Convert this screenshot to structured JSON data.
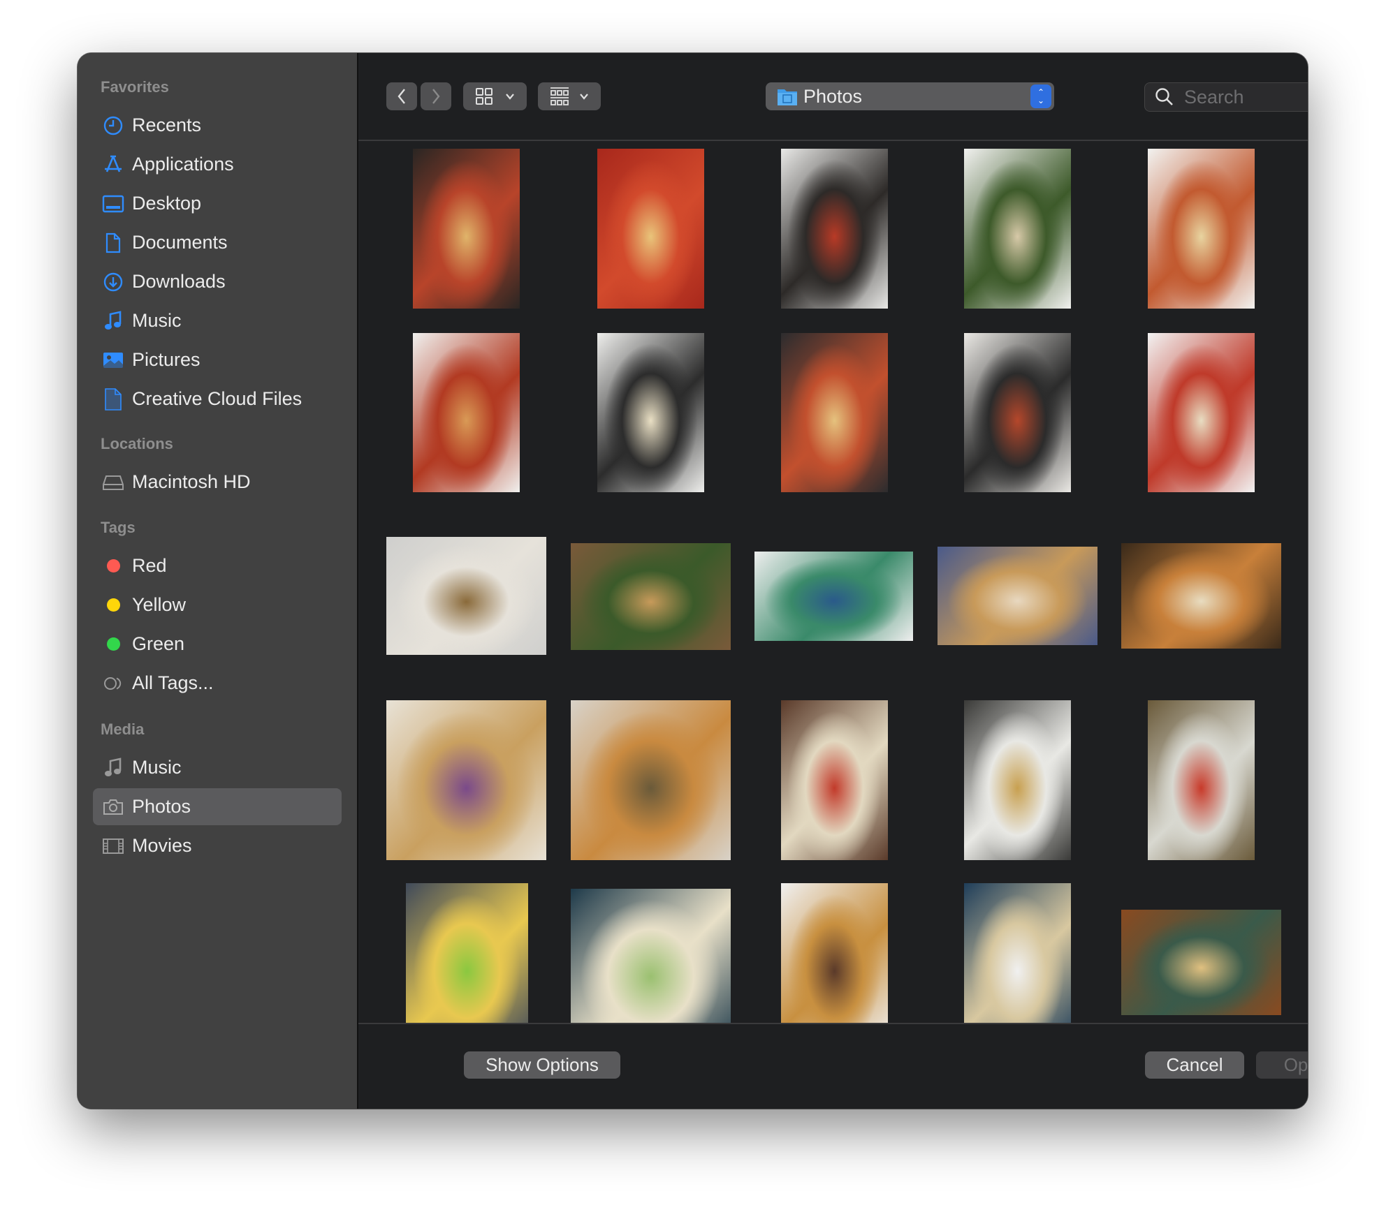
{
  "sidebar": {
    "sections": [
      {
        "title": "Favorites",
        "items": [
          {
            "label": "Recents",
            "icon": "clock-icon"
          },
          {
            "label": "Applications",
            "icon": "applications-icon"
          },
          {
            "label": "Desktop",
            "icon": "desktop-icon"
          },
          {
            "label": "Documents",
            "icon": "document-icon"
          },
          {
            "label": "Downloads",
            "icon": "download-icon"
          },
          {
            "label": "Music",
            "icon": "music-note-icon"
          },
          {
            "label": "Pictures",
            "icon": "picture-icon"
          },
          {
            "label": "Creative Cloud Files",
            "icon": "file-icon"
          }
        ]
      },
      {
        "title": "Locations",
        "items": [
          {
            "label": "Macintosh HD",
            "icon": "hard-drive-icon"
          }
        ]
      },
      {
        "title": "Tags",
        "items": [
          {
            "label": "Red",
            "icon": "tag-dot-icon",
            "color": "#ff5a52"
          },
          {
            "label": "Yellow",
            "icon": "tag-dot-icon",
            "color": "#ffd60a"
          },
          {
            "label": "Green",
            "icon": "tag-dot-icon",
            "color": "#32d74b"
          },
          {
            "label": "All Tags...",
            "icon": "all-tags-icon"
          }
        ]
      },
      {
        "title": "Media",
        "items": [
          {
            "label": "Music",
            "icon": "music-note-icon"
          },
          {
            "label": "Photos",
            "icon": "camera-icon",
            "selected": true
          },
          {
            "label": "Movies",
            "icon": "film-icon"
          }
        ]
      }
    ]
  },
  "toolbar": {
    "back_icon": "chevron-left-icon",
    "forward_icon": "chevron-right-icon",
    "view_icon": "icon-grid-icon",
    "group_icon": "group-grid-icon",
    "location": "Photos",
    "location_icon": "photos-folder-icon",
    "search_placeholder": "Search",
    "search_value": ""
  },
  "thumbnails": [
    {
      "colors": [
        "#2a2623",
        "#b8442a",
        "#e0b46a"
      ]
    },
    {
      "colors": [
        "#a8281c",
        "#d24a2c",
        "#e9c47a"
      ]
    },
    {
      "colors": [
        "#e8e8e6",
        "#2d2a28",
        "#b83a26"
      ]
    },
    {
      "colors": [
        "#f1f1ef",
        "#3d5a2a",
        "#d7c9a8"
      ]
    },
    {
      "colors": [
        "#f2f2f0",
        "#c25a30",
        "#e8d4a0"
      ]
    },
    {
      "colors": [
        "#f0f0ee",
        "#b23a22",
        "#d99a56"
      ]
    },
    {
      "colors": [
        "#eeeeec",
        "#2c2c2c",
        "#e9dfc4"
      ]
    },
    {
      "colors": [
        "#2c2c2e",
        "#c2502e",
        "#e5c27e"
      ]
    },
    {
      "colors": [
        "#eae8e4",
        "#2b2b2b",
        "#b5472b"
      ]
    },
    {
      "colors": [
        "#f2f2f2",
        "#bf3a2a",
        "#e8ddc2"
      ]
    },
    {
      "colors": [
        "#cfcfcd",
        "#e6e2da",
        "#8a6a3a"
      ]
    },
    {
      "colors": [
        "#7a5a3a",
        "#3b5a2a",
        "#c79a5a"
      ]
    },
    {
      "colors": [
        "#eeeeee",
        "#3a8a6a",
        "#2a5a8a"
      ]
    },
    {
      "colors": [
        "#4a5a8a",
        "#c89a5a",
        "#e8d8c0"
      ]
    },
    {
      "colors": [
        "#3a2a1a",
        "#c8803a",
        "#e8dcc0"
      ]
    },
    {
      "colors": [
        "#e8e2d6",
        "#c9a060",
        "#7a4a8a"
      ]
    },
    {
      "colors": [
        "#d8d2c8",
        "#c98a40",
        "#6a5a3a"
      ]
    },
    {
      "colors": [
        "#5a3a2a",
        "#e2d8c0",
        "#c23a2a"
      ]
    },
    {
      "colors": [
        "#3a3a38",
        "#e8e8e4",
        "#c8a050"
      ]
    },
    {
      "colors": [
        "#6a5a3a",
        "#d8d8d0",
        "#c83a2a"
      ]
    },
    {
      "colors": [
        "#404a5a",
        "#e8c850",
        "#8ac840"
      ]
    },
    {
      "colors": [
        "#1e3a4a",
        "#e8e0c8",
        "#9ac070"
      ]
    },
    {
      "colors": [
        "#f0f0f0",
        "#c89040",
        "#5a3a2a"
      ]
    },
    {
      "colors": [
        "#1f3e5a",
        "#d8c8a0",
        "#f0f0f0"
      ]
    },
    {
      "colors": [
        "#8a4a20",
        "#3a5a4a",
        "#e0c080"
      ]
    }
  ],
  "footer": {
    "show_options": "Show Options",
    "cancel": "Cancel",
    "open": "Open",
    "open_enabled": false
  },
  "colors": {
    "accent": "#2f6fe0",
    "sidebar_icon": "#2f8cff",
    "selection": "#5b5b5d"
  }
}
